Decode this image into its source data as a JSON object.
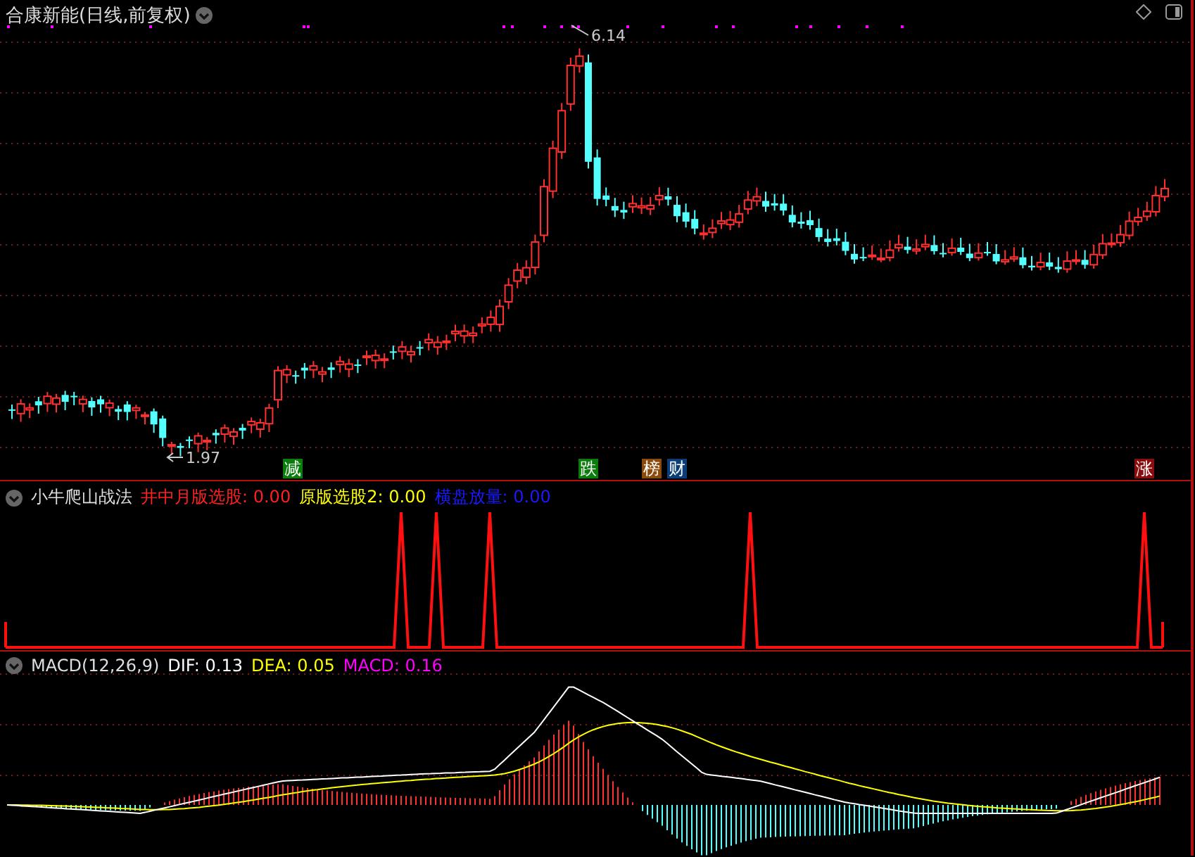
{
  "main_chart": {
    "title": "合康新能(日线,前复权)",
    "price_labels": [
      {
        "kind": "high",
        "text": "6.14"
      },
      {
        "kind": "low",
        "text": "1.97"
      }
    ],
    "signals": [
      {
        "label": "减",
        "color": "#0b7d0b"
      },
      {
        "label": "跌",
        "color": "#0b7d0b"
      },
      {
        "label": "榜",
        "color": "#8c4b0c"
      },
      {
        "label": "财",
        "color": "#0c3d78"
      },
      {
        "label": "涨",
        "color": "#8a0c0c"
      }
    ]
  },
  "indicator_panel": {
    "title": "小牛爬山战法",
    "readings": [
      {
        "text": "井中月版选股: 0.00",
        "color": "#ff2020"
      },
      {
        "text": "原版选股2: 0.00",
        "color": "#ffff00"
      },
      {
        "text": "横盘放量: 0.00",
        "color": "#1a1aff"
      }
    ]
  },
  "macd_panel": {
    "title": "MACD(12,26,9)",
    "readings": [
      {
        "text": "DIF: 0.13",
        "color": "#ffffff"
      },
      {
        "text": "DEA: 0.05",
        "color": "#ffff00"
      },
      {
        "text": "MACD: 0.16",
        "color": "#ff00ff"
      }
    ]
  }
}
